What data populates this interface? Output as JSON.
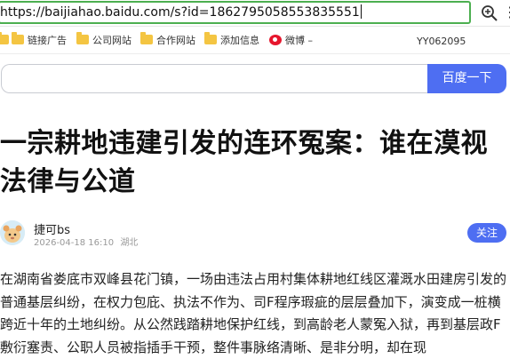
{
  "browser": {
    "url": "https://baijiahao.baidu.com/s?id=1862795058553835551"
  },
  "bookmarks": {
    "items": [
      {
        "label": "",
        "type": "folder"
      },
      {
        "label": "链接广告",
        "type": "folder"
      },
      {
        "label": "公司网站",
        "type": "folder"
      },
      {
        "label": "合作网站",
        "type": "folder"
      },
      {
        "label": "添加信息",
        "type": "folder"
      },
      {
        "label": "微博 –",
        "type": "weibo"
      }
    ],
    "right_text": "YY062095"
  },
  "search": {
    "button_label": "百度一下"
  },
  "article": {
    "title": "一宗耕地违建引发的连环冤案：谁在漠视法律与公道",
    "author": "捷可bs",
    "datetime": "2026-04-18 16:10",
    "location": "湖北",
    "follow_label": "关注",
    "body": "在湖南省娄底市双峰县花门镇，一场由违法占用村集体耕地红线区灌溉水田建房引发的普通基层纠纷，在权力包庇、执法不作为、司F程序瑕疵的层层叠加下，演变成一桩横跨近十年的土地纠纷。从公然践踏耕地保护红线，到高龄老人蒙冤入狱，再到基层政F敷衍塞责、公职人员被指插手干预，整件事脉络清晰、是非分明，却在现"
  },
  "colors": {
    "accent": "#4e6ef2",
    "url_border": "#4caf50",
    "folder": "#f4c542",
    "weibo": "#e6162d"
  }
}
